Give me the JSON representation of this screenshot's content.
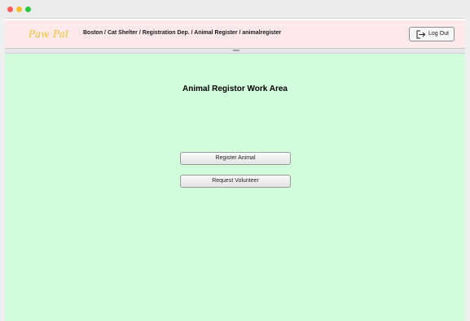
{
  "app": {
    "logo": "Paw Pal",
    "breadcrumb": "Boston / Cat Shelter / Registration Dep. / Animal Register / animalregister",
    "logout_label": "Log Out"
  },
  "work_area": {
    "title": "Animal Registor Work Area",
    "buttons": {
      "register_animal": "Register Animal",
      "request_volunteer": "Request Volunteer"
    }
  },
  "colors": {
    "header_bg": "#fde9e9",
    "work_area_bg": "#d2fddc",
    "logo": "#f1c232"
  },
  "icons": {
    "logout": "logout-icon",
    "window_controls": [
      "close-icon",
      "minimize-icon",
      "maximize-icon"
    ]
  }
}
